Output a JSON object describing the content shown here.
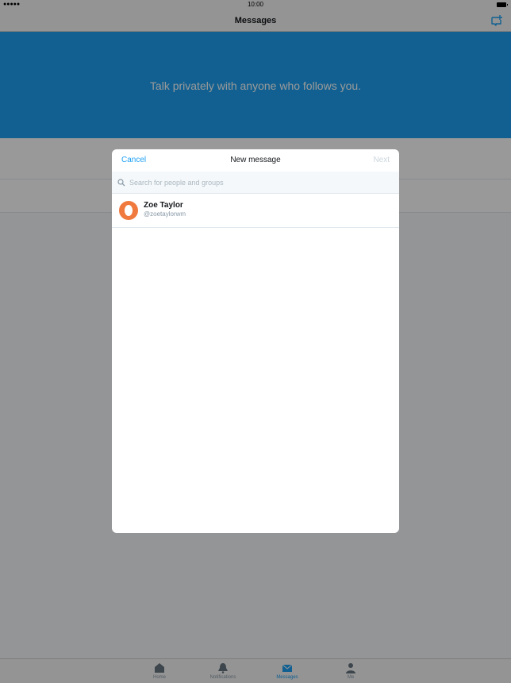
{
  "status_bar": {
    "signal": "●●●●●",
    "time": "10:00"
  },
  "nav": {
    "title": "Messages"
  },
  "hero": {
    "text": "Talk privately with anyone who follows you."
  },
  "tabs": [
    {
      "label": "Home",
      "icon": "home-icon"
    },
    {
      "label": "Notifications",
      "icon": "bell-icon"
    },
    {
      "label": "Messages",
      "icon": "envelope-icon",
      "active": true
    },
    {
      "label": "Me",
      "icon": "person-icon"
    }
  ],
  "modal": {
    "cancel_label": "Cancel",
    "title": "New message",
    "next_label": "Next",
    "search": {
      "placeholder": "Search for people and groups",
      "value": ""
    },
    "results": [
      {
        "name": "Zoe Taylor",
        "handle": "@zoetaylorwm"
      }
    ]
  },
  "colors": {
    "accent": "#1da1f2",
    "avatar": "#f07a3e"
  }
}
